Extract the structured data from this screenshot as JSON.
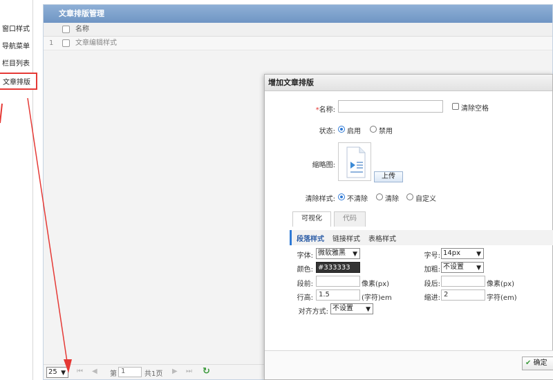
{
  "sidebar": {
    "items": [
      {
        "label": "窗口样式"
      },
      {
        "label": "导航菜单"
      },
      {
        "label": "栏目列表"
      },
      {
        "label": "文章排版"
      }
    ]
  },
  "main": {
    "title": "文章排版管理",
    "grid": {
      "header": "名称",
      "rows": [
        {
          "index": "1",
          "name": "文章编辑样式"
        }
      ]
    },
    "pager": {
      "page_size": "25",
      "page_prefix": "第",
      "page_value": "1",
      "total_text": "共1页"
    }
  },
  "dialog": {
    "title": "增加文章排版",
    "name_label": "名称:",
    "name_value": "",
    "clear_space_label": "清除空格",
    "status_label": "状态:",
    "status_enable": "启用",
    "status_disable": "禁用",
    "thumb_label": "缩略图:",
    "upload_label": "上传",
    "clear_style_label": "清除样式:",
    "clear_opt_none": "不清除",
    "clear_opt_clear": "清除",
    "clear_opt_custom": "自定义",
    "tabs": {
      "visual": "可视化",
      "code": "代码"
    },
    "subtabs": {
      "paragraph": "段落样式",
      "link": "链接样式",
      "table": "表格样式"
    },
    "fields": {
      "font_label": "字体:",
      "font_value": "微软雅黑",
      "size_label": "字号:",
      "size_value": "14px",
      "color_label": "颜色:",
      "color_value": "#333333",
      "bold_label": "加粗:",
      "bold_value": "不设置",
      "before_label": "段前:",
      "before_value": "",
      "before_unit": "像素(px)",
      "after_label": "段后:",
      "after_value": "",
      "after_unit": "像素(px)",
      "line_label": "行高:",
      "line_value": "1.5",
      "line_unit": "(字符)em",
      "indent_label": "缩进:",
      "indent_value": "2",
      "indent_unit": "字符(em)",
      "align_label": "对齐方式:",
      "align_value": "不设置"
    },
    "ok_label": "确定"
  },
  "colors": {
    "accent": "#2f7ad6",
    "annotation": "#e53935",
    "title_bar": "#7fa3cf"
  }
}
